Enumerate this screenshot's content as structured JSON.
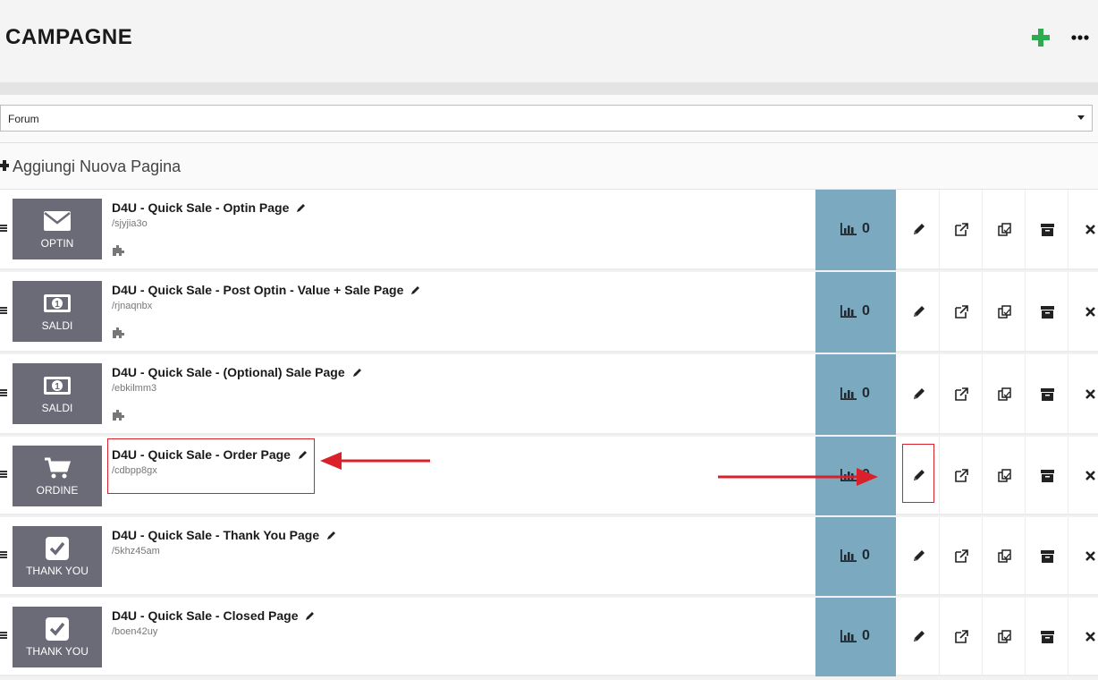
{
  "header": {
    "title": "CAMPAGNE",
    "add_icon": "plus-icon",
    "more_icon": "ellipsis-icon",
    "accent": "#2eaa50"
  },
  "funnel_select": {
    "value": "Forum"
  },
  "add_page": {
    "label": "Aggiungi Nuova Pagina"
  },
  "stats_color": "#7aa9c0",
  "pages": [
    {
      "type_label": "OPTIN",
      "type_icon": "envelope-icon",
      "name": "D4U - Quick Sale - Optin Page",
      "url": "/sjyjia3o",
      "has_plugin": true,
      "stats": "0"
    },
    {
      "type_label": "SALDI",
      "type_icon": "money-icon",
      "name": "D4U - Quick Sale - Post Optin - Value + Sale Page",
      "url": "/rjnaqnbx",
      "has_plugin": true,
      "stats": "0"
    },
    {
      "type_label": "SALDI",
      "type_icon": "money-icon",
      "name": "D4U - Quick Sale - (Optional) Sale Page",
      "url": "/ebkilmm3",
      "has_plugin": true,
      "stats": "0"
    },
    {
      "type_label": "ORDINE",
      "type_icon": "cart-icon",
      "name": "D4U - Quick Sale - Order Page",
      "url": "/cdbpp8gx",
      "has_plugin": false,
      "stats": "0"
    },
    {
      "type_label": "THANK YOU",
      "type_icon": "checkbox-icon",
      "name": "D4U - Quick Sale - Thank You Page",
      "url": "/5khz45am",
      "has_plugin": false,
      "stats": "0"
    },
    {
      "type_label": "THANK YOU",
      "type_icon": "checkbox-icon",
      "name": "D4U - Quick Sale - Closed Page",
      "url": "/boen42uy",
      "has_plugin": false,
      "stats": "0"
    }
  ],
  "row_actions": [
    "edit-icon",
    "external-link-icon",
    "clone-icon",
    "archive-icon",
    "delete-icon"
  ],
  "annotation_color": "#d9202b"
}
